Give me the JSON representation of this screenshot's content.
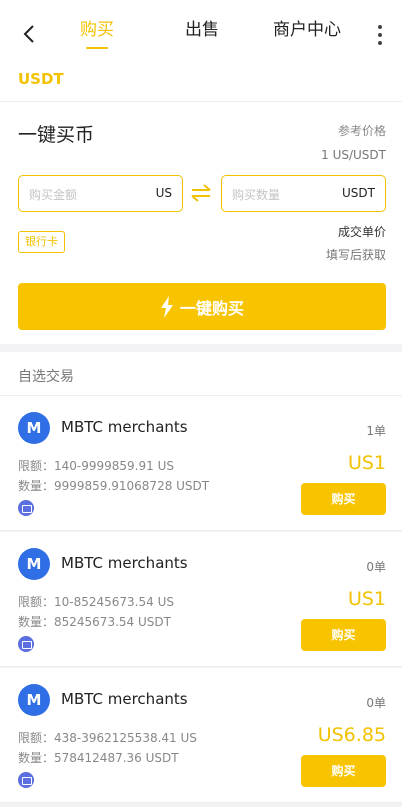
{
  "header": {
    "tabs": [
      {
        "label": "购买",
        "active": true
      },
      {
        "label": "出售",
        "active": false
      },
      {
        "label": "商户中心",
        "active": false
      }
    ]
  },
  "coin": "USDT",
  "quick_buy": {
    "title": "一键买币",
    "ref_price_label": "参考价格",
    "ref_price_value": "1 US/USDT",
    "amount_placeholder": "购买金额",
    "amount_unit": "US",
    "qty_placeholder": "购买数量",
    "qty_unit": "USDT",
    "bank_tag": "银行卡",
    "deal_price_label": "成交单价",
    "deal_price_hint": "填写后获取",
    "buy_button": "一键购买"
  },
  "section_title": "自选交易",
  "merchants": [
    {
      "avatar": "M",
      "name": "MBTC merchants",
      "orders": "1单",
      "limit": "限额：140-9999859.91 US",
      "quantity": "数量：9999859.91068728 USDT",
      "price": "US1",
      "button": "购买"
    },
    {
      "avatar": "M",
      "name": "MBTC merchants",
      "orders": "0单",
      "limit": "限额：10-85245673.54 US",
      "quantity": "数量：85245673.54 USDT",
      "price": "US1",
      "button": "购买"
    },
    {
      "avatar": "M",
      "name": "MBTC merchants",
      "orders": "0单",
      "limit": "限额：438-3962125538.41 US",
      "quantity": "数量：578412487.36 USDT",
      "price": "US6.85",
      "button": "购买"
    }
  ],
  "colors": {
    "accent": "#f8c400",
    "avatar": "#2f6ee5",
    "payment_icon": "#5b6fe0"
  }
}
